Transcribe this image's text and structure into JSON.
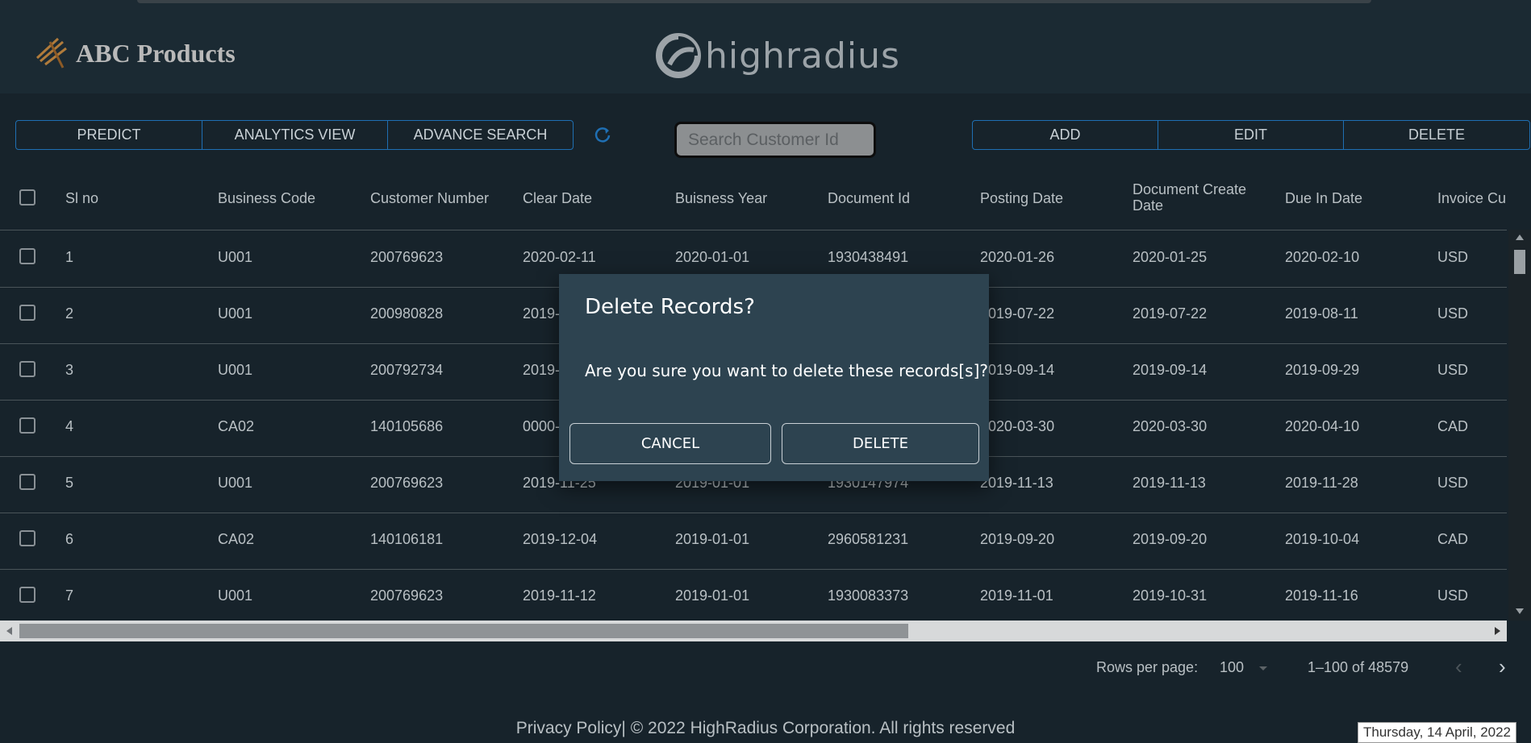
{
  "header": {
    "company": "ABC Products",
    "brand": "highradius"
  },
  "toolbar": {
    "left": [
      "PREDICT",
      "ANALYTICS VIEW",
      "ADVANCE SEARCH"
    ],
    "right": [
      "ADD",
      "EDIT",
      "DELETE"
    ],
    "search_placeholder": "Search Customer Id"
  },
  "table": {
    "columns": [
      "Sl no",
      "Business Code",
      "Customer Number",
      "Clear Date",
      "Buisness Year",
      "Document Id",
      "Posting Date",
      "Document Create Date",
      "Due In Date",
      "Invoice Curre"
    ],
    "rows": [
      [
        "1",
        "U001",
        "200769623",
        "2020-02-11",
        "2020-01-01",
        "1930438491",
        "2020-01-26",
        "2020-01-25",
        "2020-02-10",
        "USD"
      ],
      [
        "2",
        "U001",
        "200980828",
        "2019-",
        "",
        "",
        "2019-07-22",
        "2019-07-22",
        "2019-08-11",
        "USD"
      ],
      [
        "3",
        "U001",
        "200792734",
        "2019-",
        "",
        "",
        "2019-09-14",
        "2019-09-14",
        "2019-09-29",
        "USD"
      ],
      [
        "4",
        "CA02",
        "140105686",
        "0000-",
        "",
        "",
        "2020-03-30",
        "2020-03-30",
        "2020-04-10",
        "CAD"
      ],
      [
        "5",
        "U001",
        "200769623",
        "2019-11-25",
        "2019-01-01",
        "1930147974",
        "2019-11-13",
        "2019-11-13",
        "2019-11-28",
        "USD"
      ],
      [
        "6",
        "CA02",
        "140106181",
        "2019-12-04",
        "2019-01-01",
        "2960581231",
        "2019-09-20",
        "2019-09-20",
        "2019-10-04",
        "CAD"
      ],
      [
        "7",
        "U001",
        "200769623",
        "2019-11-12",
        "2019-01-01",
        "1930083373",
        "2019-11-01",
        "2019-10-31",
        "2019-11-16",
        "USD"
      ]
    ]
  },
  "pagination": {
    "rows_label": "Rows per page:",
    "rows_value": "100",
    "range": "1–100 of 48579"
  },
  "footer": {
    "text": "Privacy Policy| © 2022 HighRadius Corporation. All rights reserved",
    "date": "Thursday, 14 April, 2022"
  },
  "dialog": {
    "title": "Delete Records?",
    "message": "Are you sure you want to delete these records[s]?",
    "cancel": "CANCEL",
    "confirm": "DELETE"
  },
  "colors": {
    "background": "#17232b",
    "dialog": "#2d4350",
    "accent_border": "#1f6fb3"
  },
  "icons": [
    "abc-logo-icon",
    "highradius-logo-icon",
    "refresh-icon",
    "dropdown-caret-icon",
    "chevron-left-icon",
    "chevron-right-icon"
  ]
}
